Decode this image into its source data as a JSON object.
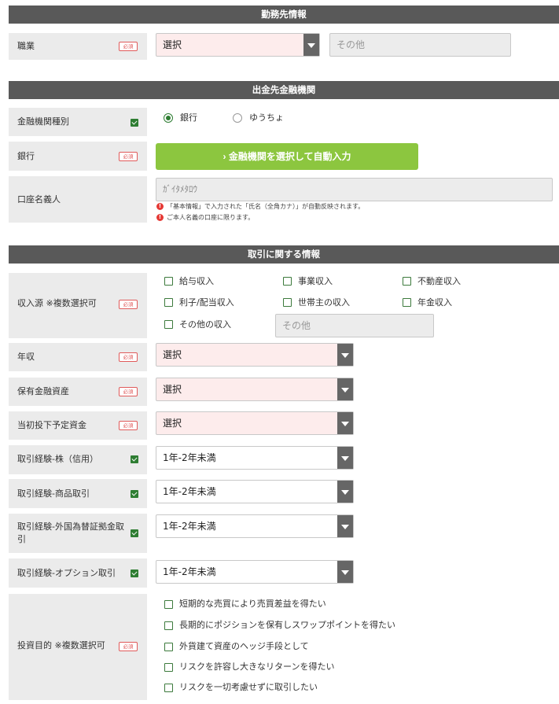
{
  "sections": {
    "work": "勤務先情報",
    "bank": "出金先金融機関",
    "trade": "取引に関する情報"
  },
  "required_badge": "必須",
  "occupation": {
    "label": "職業",
    "select_value": "選択",
    "other_placeholder": "その他"
  },
  "bank_type": {
    "label": "金融機関種別",
    "options": [
      "銀行",
      "ゆうちょ"
    ],
    "selected": "銀行"
  },
  "bank": {
    "label": "銀行",
    "button_label": "金融機関を選択して自動入力",
    "button_icon": "chevron-right-icon"
  },
  "account_holder": {
    "label": "口座名義人",
    "value": "ｶﾞｲﾀﾒﾀﾛｳ",
    "notes": [
      "「基本情報」で入力された「氏名（全角カナ）」が自動反映されます。",
      "ご本人名義の口座に限ります。"
    ]
  },
  "income_source": {
    "label": "収入源 ※複数選択可",
    "options": [
      "給与収入",
      "事業収入",
      "不動産収入",
      "利子/配当収入",
      "世帯主の収入",
      "年金収入",
      "その他の収入"
    ],
    "other_placeholder": "その他"
  },
  "annual_income": {
    "label": "年収",
    "value": "選択"
  },
  "financial_assets": {
    "label": "保有金融資産",
    "value": "選択"
  },
  "initial_investment": {
    "label": "当初投下予定資金",
    "value": "選択"
  },
  "exp_stock": {
    "label": "取引経験-株（信用）",
    "value": "1年-2年未満"
  },
  "exp_commodity": {
    "label": "取引経験-商品取引",
    "value": "1年-2年未満"
  },
  "exp_fx": {
    "label_line1": "取引経験-外国為替証拠金取",
    "label_line2": "引",
    "value": "1年-2年未満"
  },
  "exp_option": {
    "label": "取引経験-オプション取引",
    "value": "1年-2年未満"
  },
  "purpose": {
    "label": "投資目的 ※複数選択可",
    "options": [
      "短期的な売買により売買差益を得たい",
      "長期的にポジションを保有しスワップポイントを得たい",
      "外貨建て資産のヘッジ手段として",
      "リスクを許容し大きなリターンを得たい",
      "リスクを一切考慮せずに取引したい"
    ]
  },
  "colors": {
    "header_bg": "#595959",
    "label_bg": "#ebebeb",
    "required": "#e05a5a",
    "accent_green": "#8cc63f",
    "checkbox_green": "#2e7d32",
    "select_pink": "#fdecec"
  }
}
